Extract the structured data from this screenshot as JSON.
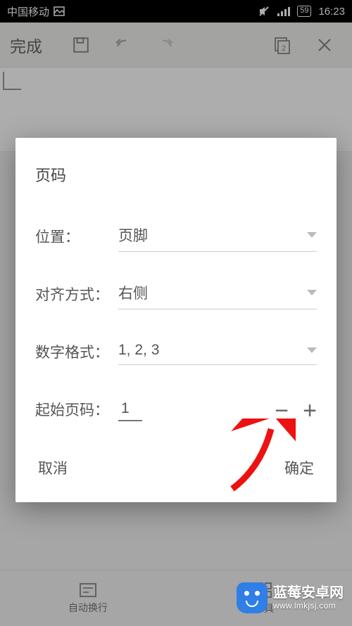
{
  "status": {
    "carrier": "中国移动",
    "battery_text": "59",
    "time": "16:23"
  },
  "toolbar": {
    "done_label": "完成",
    "page_indicator": "2"
  },
  "dialog": {
    "title": "页码",
    "position": {
      "label": "位置：",
      "value": "页脚"
    },
    "alignment": {
      "label": "对齐方式：",
      "value": "右侧"
    },
    "format": {
      "label": "数字格式：",
      "value": "1, 2, 3"
    },
    "start": {
      "label": "起始页码：",
      "value": "1"
    },
    "cancel": "取消",
    "confirm": "确定"
  },
  "bottom": {
    "wrap": "自动换行",
    "tools": "工具"
  },
  "watermark": {
    "name": "蓝莓安卓网",
    "url": "www.lmkjsj.com"
  }
}
